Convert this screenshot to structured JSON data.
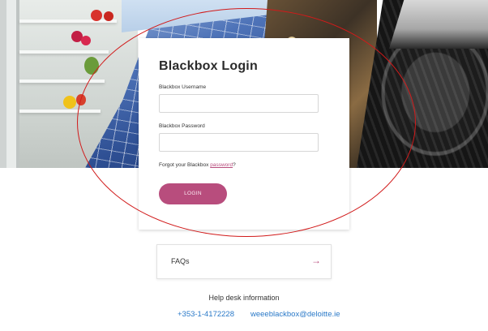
{
  "login": {
    "title": "Blackbox Login",
    "username_label": "Blackbox Username",
    "username_value": "",
    "password_label": "Blackbox Password",
    "password_value": "",
    "forgot_prefix": "Forgot your Blackbox ",
    "forgot_link": "password",
    "forgot_suffix": "?",
    "button_label": "LOGIN"
  },
  "faq": {
    "label": "FAQs",
    "arrow_icon": "arrow-right-icon"
  },
  "help": {
    "title": "Help desk information",
    "phone": "+353-1-4172228",
    "email": "weeeblackbox@deloitte.ie"
  },
  "colors": {
    "accent": "#b84d7d",
    "link": "#2a79c8",
    "annotation": "#d11a1a"
  }
}
